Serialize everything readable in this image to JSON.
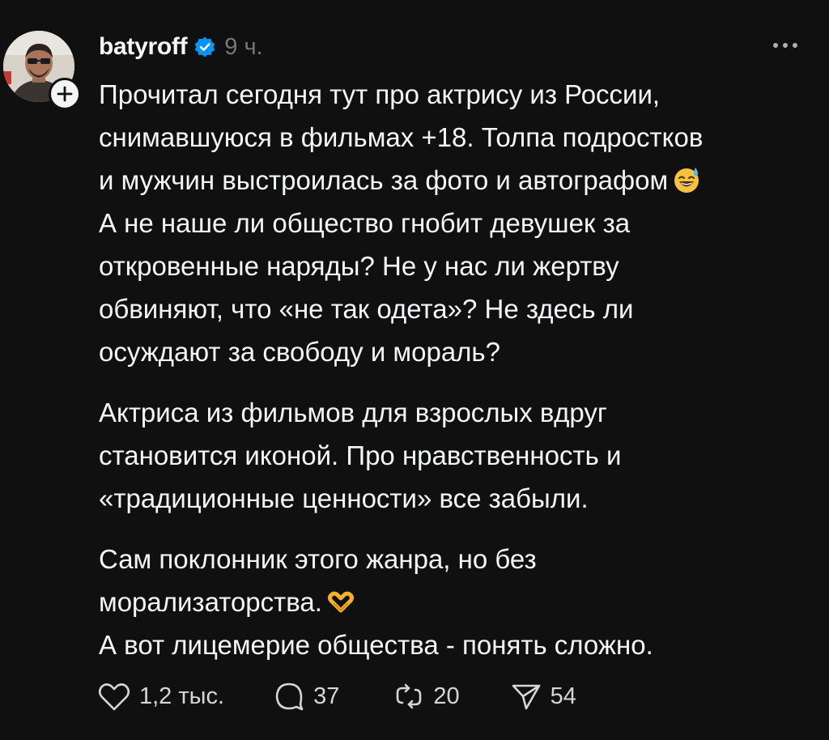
{
  "post": {
    "username": "batyroff",
    "time": "9 ч.",
    "lines": [
      "Прочитал сегодня тут про актрису из России,",
      "снимавшуюся в фильмах +18. Толпа подростков",
      "и мужчин выстроилась за фото и автографом",
      "А не наше ли общество гнобит девушек за",
      "откровенные наряды? Не у нас ли жертву",
      "обвиняют, что «не так одета»? Не здесь ли",
      "осуждают за свободу и мораль?",
      "Актриса из фильмов для взрослых вдруг",
      "становится иконой. Про нравственность и",
      "«традиционные ценности» все забыли.",
      "Сам поклонник этого жанра, но без",
      "морализаторства.",
      "А вот лицемерие общества - понять сложно."
    ],
    "emojis": [
      "sweat-smile-emoji",
      "heart-hands-emoji"
    ]
  },
  "actions": {
    "likes": "1,2 тыс.",
    "replies": "37",
    "reposts": "20",
    "shares": "54"
  },
  "icons": [
    "verified-icon",
    "more-icon",
    "plus-icon",
    "heart-icon",
    "comment-icon",
    "repost-icon",
    "share-icon"
  ],
  "colors": {
    "background": "#101010",
    "text": "#f3f5f7",
    "muted": "#777777",
    "verified": "#0095f6"
  }
}
